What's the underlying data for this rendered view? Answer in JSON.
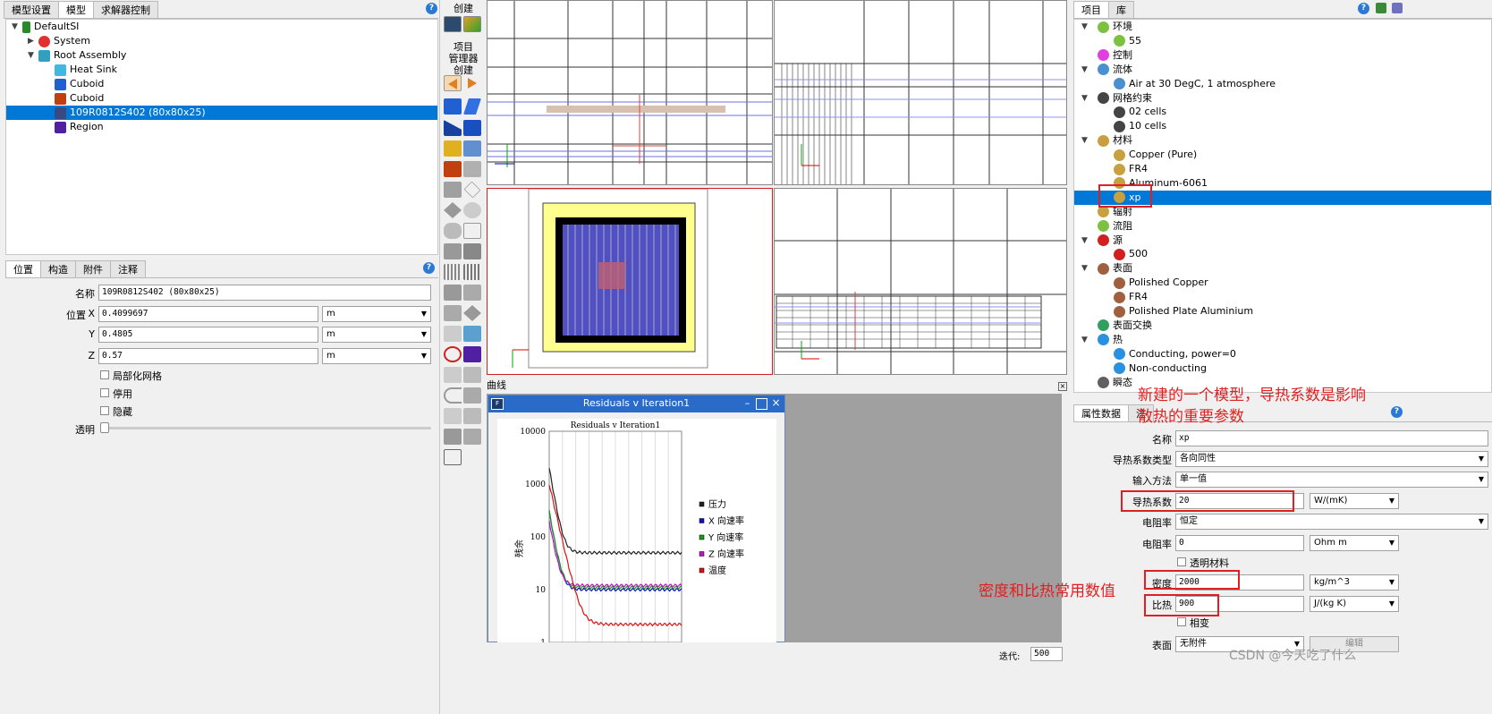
{
  "left_tabs": [
    "模型设置",
    "模型",
    "求解器控制"
  ],
  "tree": {
    "root": "DefaultSI",
    "items": [
      "System",
      "Root Assembly",
      "Heat Sink",
      "Cuboid",
      "Cuboid",
      "109R0812S402 (80x80x25)",
      "Region"
    ]
  },
  "prop_tabs": [
    "位置",
    "构造",
    "附件",
    "注释"
  ],
  "prop": {
    "name_label": "名称",
    "name_value": "109R0812S402 (80x80x25)",
    "pos_label": "位置",
    "x_label": "X",
    "x_value": "0.4099697",
    "y_label": "Y",
    "y_value": "0.4805",
    "z_label": "Z",
    "z_value": "0.57",
    "unit": "m",
    "local_mesh": "局部化网格",
    "disable": "停用",
    "hide": "隐藏",
    "transparent": "透明"
  },
  "toolbar": {
    "create": "创建",
    "pm_line1": "项目",
    "pm_line2": "管理器",
    "pm_line3": "创建"
  },
  "plot_panel": {
    "label": "曲线",
    "window_title": "Residuals v Iteration1",
    "inner_title": "Residuals v Iteration1",
    "ylabel": "残余",
    "iter_label": "迭代:",
    "iter_value": "500"
  },
  "chart_data": {
    "type": "line",
    "title": "Residuals v Iteration1",
    "ylabel": "残余",
    "yscale": "log",
    "ylim": [
      1,
      10000
    ],
    "yticks": [
      "10000",
      "1000",
      "100",
      "10",
      "1"
    ],
    "legend_position": "right",
    "series": [
      {
        "name": "压力",
        "color": "#222222"
      },
      {
        "name": "X 向速率",
        "color": "#1010c0"
      },
      {
        "name": "Y 向速率",
        "color": "#10a010"
      },
      {
        "name": "Z 向速率",
        "color": "#c010c0"
      },
      {
        "name": "温度",
        "color": "#e01010"
      }
    ]
  },
  "right_tabs": [
    "项目",
    "库"
  ],
  "project_tree": [
    {
      "label": "环境",
      "level": 0,
      "exp": true,
      "color": "#7cc142"
    },
    {
      "label": "55",
      "level": 1,
      "color": "#7cc142"
    },
    {
      "label": "控制",
      "level": 0,
      "color": "#e040e0"
    },
    {
      "label": "流体",
      "level": 0,
      "exp": true,
      "color": "#4a90d0"
    },
    {
      "label": "Air at 30 DegC, 1 atmosphere",
      "level": 1,
      "color": "#4a90d0"
    },
    {
      "label": "网格约束",
      "level": 0,
      "exp": true,
      "color": "#444444"
    },
    {
      "label": "02 cells",
      "level": 1,
      "color": "#444444"
    },
    {
      "label": "10 cells",
      "level": 1,
      "color": "#444444"
    },
    {
      "label": "材料",
      "level": 0,
      "exp": true,
      "color": "#c8a040"
    },
    {
      "label": "Copper (Pure)",
      "level": 1,
      "color": "#c8a040"
    },
    {
      "label": "FR4",
      "level": 1,
      "color": "#c8a040"
    },
    {
      "label": "Aluminum-6061",
      "level": 1,
      "color": "#c8a040"
    },
    {
      "label": "xp",
      "level": 1,
      "color": "#c8a040",
      "selected": true
    },
    {
      "label": "辐射",
      "level": 0,
      "color": "#c8a040"
    },
    {
      "label": "流阻",
      "level": 0,
      "color": "#7cc142"
    },
    {
      "label": "源",
      "level": 0,
      "exp": true,
      "color": "#d02020"
    },
    {
      "label": "500",
      "level": 1,
      "color": "#d02020"
    },
    {
      "label": "表面",
      "level": 0,
      "exp": true,
      "color": "#a06040"
    },
    {
      "label": "Polished Copper",
      "level": 1,
      "color": "#a06040"
    },
    {
      "label": "FR4",
      "level": 1,
      "color": "#a06040"
    },
    {
      "label": "Polished Plate Aluminium",
      "level": 1,
      "color": "#a06040"
    },
    {
      "label": "表面交换",
      "level": 0,
      "color": "#30a060"
    },
    {
      "label": "热",
      "level": 0,
      "exp": true,
      "color": "#2a90e0"
    },
    {
      "label": "Conducting, power=0",
      "level": 1,
      "color": "#2a90e0"
    },
    {
      "label": "Non-conducting",
      "level": 1,
      "color": "#2a90e0"
    },
    {
      "label": "瞬态",
      "level": 0,
      "color": "#606060"
    }
  ],
  "attr_tabs": [
    "属性数据",
    "注"
  ],
  "attr": {
    "name_label": "名称",
    "name_value": "xp",
    "ktype_label": "导热系数类型",
    "ktype_value": "各向同性",
    "input_label": "输入方法",
    "input_value": "单一值",
    "k_label": "导热系数",
    "k_value": "20",
    "k_unit": "W/(mK)",
    "res_label": "电阻率",
    "res_value": "恒定",
    "res2_label": "电阻率",
    "res2_value": "0",
    "res2_unit": "Ohm m",
    "transp_label": "透明材料",
    "dens_label": "密度",
    "dens_value": "2000",
    "dens_unit": "kg/m^3",
    "cp_label": "比热",
    "cp_value": "900",
    "cp_unit": "J/(kg K)",
    "phase_label": "相变",
    "surf_label": "表面",
    "surf_value": "无附件",
    "edit_label": "编辑"
  },
  "annotations": {
    "note1": "新建的一个模型，导热系数是影响散热的重要参数",
    "note2": "密度和比热常用数值"
  },
  "watermark": "CSDN @今天吃了什么"
}
